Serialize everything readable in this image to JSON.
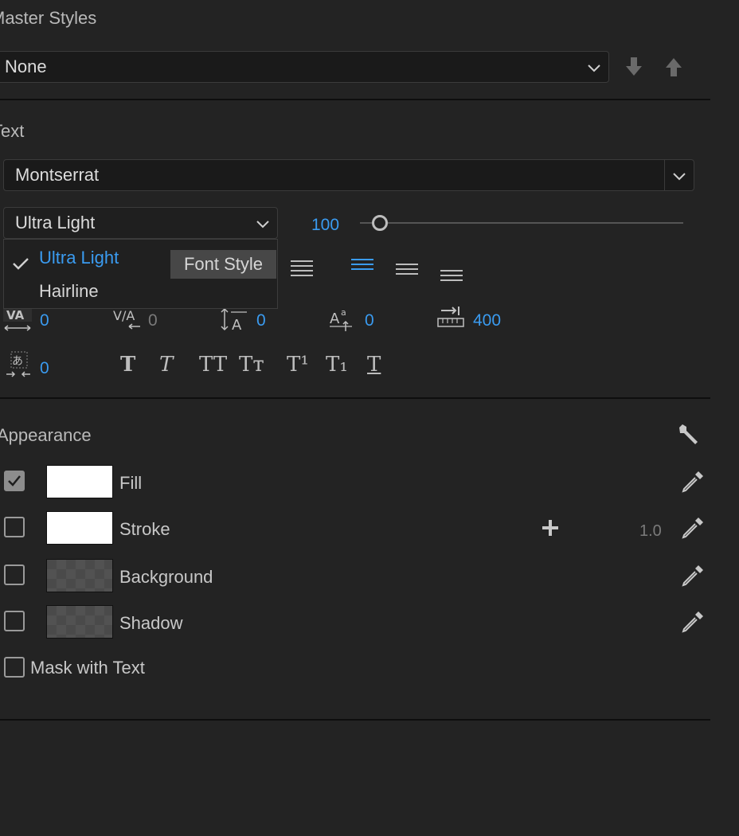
{
  "master_styles": {
    "label": "Master Styles",
    "selected": "None",
    "icons": [
      "chevron-down-icon",
      "arrow-down-icon",
      "arrow-up-icon"
    ]
  },
  "text_section": {
    "label": "Text",
    "font_family": "Montserrat",
    "font_style": "Ultra Light",
    "font_size": "100",
    "font_size_slider_fraction": 0.05,
    "font_style_menu": {
      "options": [
        {
          "label": "Ultra Light",
          "selected": true
        },
        {
          "label": "Hairline",
          "selected": false
        }
      ]
    },
    "tooltip": "Font Style",
    "metrics": {
      "kerning": "0",
      "tracking": "0",
      "leading": "0",
      "baseline_shift": "0",
      "tab_width": "400",
      "tsume": "0"
    },
    "type_buttons": [
      {
        "name": "faux-bold-button",
        "glyph": "T"
      },
      {
        "name": "faux-italic-button",
        "glyph": "T"
      },
      {
        "name": "all-caps-button",
        "glyph": "TT"
      },
      {
        "name": "small-caps-button",
        "glyph": "Tт"
      },
      {
        "name": "superscript-button",
        "glyph": "T¹"
      },
      {
        "name": "subscript-button",
        "glyph": "T₁"
      },
      {
        "name": "underline-button",
        "glyph": "T"
      }
    ]
  },
  "appearance": {
    "label": "Appearance",
    "rows": [
      {
        "label": "Fill",
        "checked": true,
        "swatch": "#ffffff"
      },
      {
        "label": "Stroke",
        "checked": false,
        "swatch": "#ffffff",
        "width": "1.0"
      },
      {
        "label": "Background",
        "checked": false,
        "swatch": "transparent"
      },
      {
        "label": "Shadow",
        "checked": false,
        "swatch": "transparent"
      }
    ],
    "mask_with_text": {
      "label": "Mask with Text",
      "checked": false
    }
  },
  "colors": {
    "accent": "#3a9bf0",
    "panel_bg": "#232323"
  }
}
